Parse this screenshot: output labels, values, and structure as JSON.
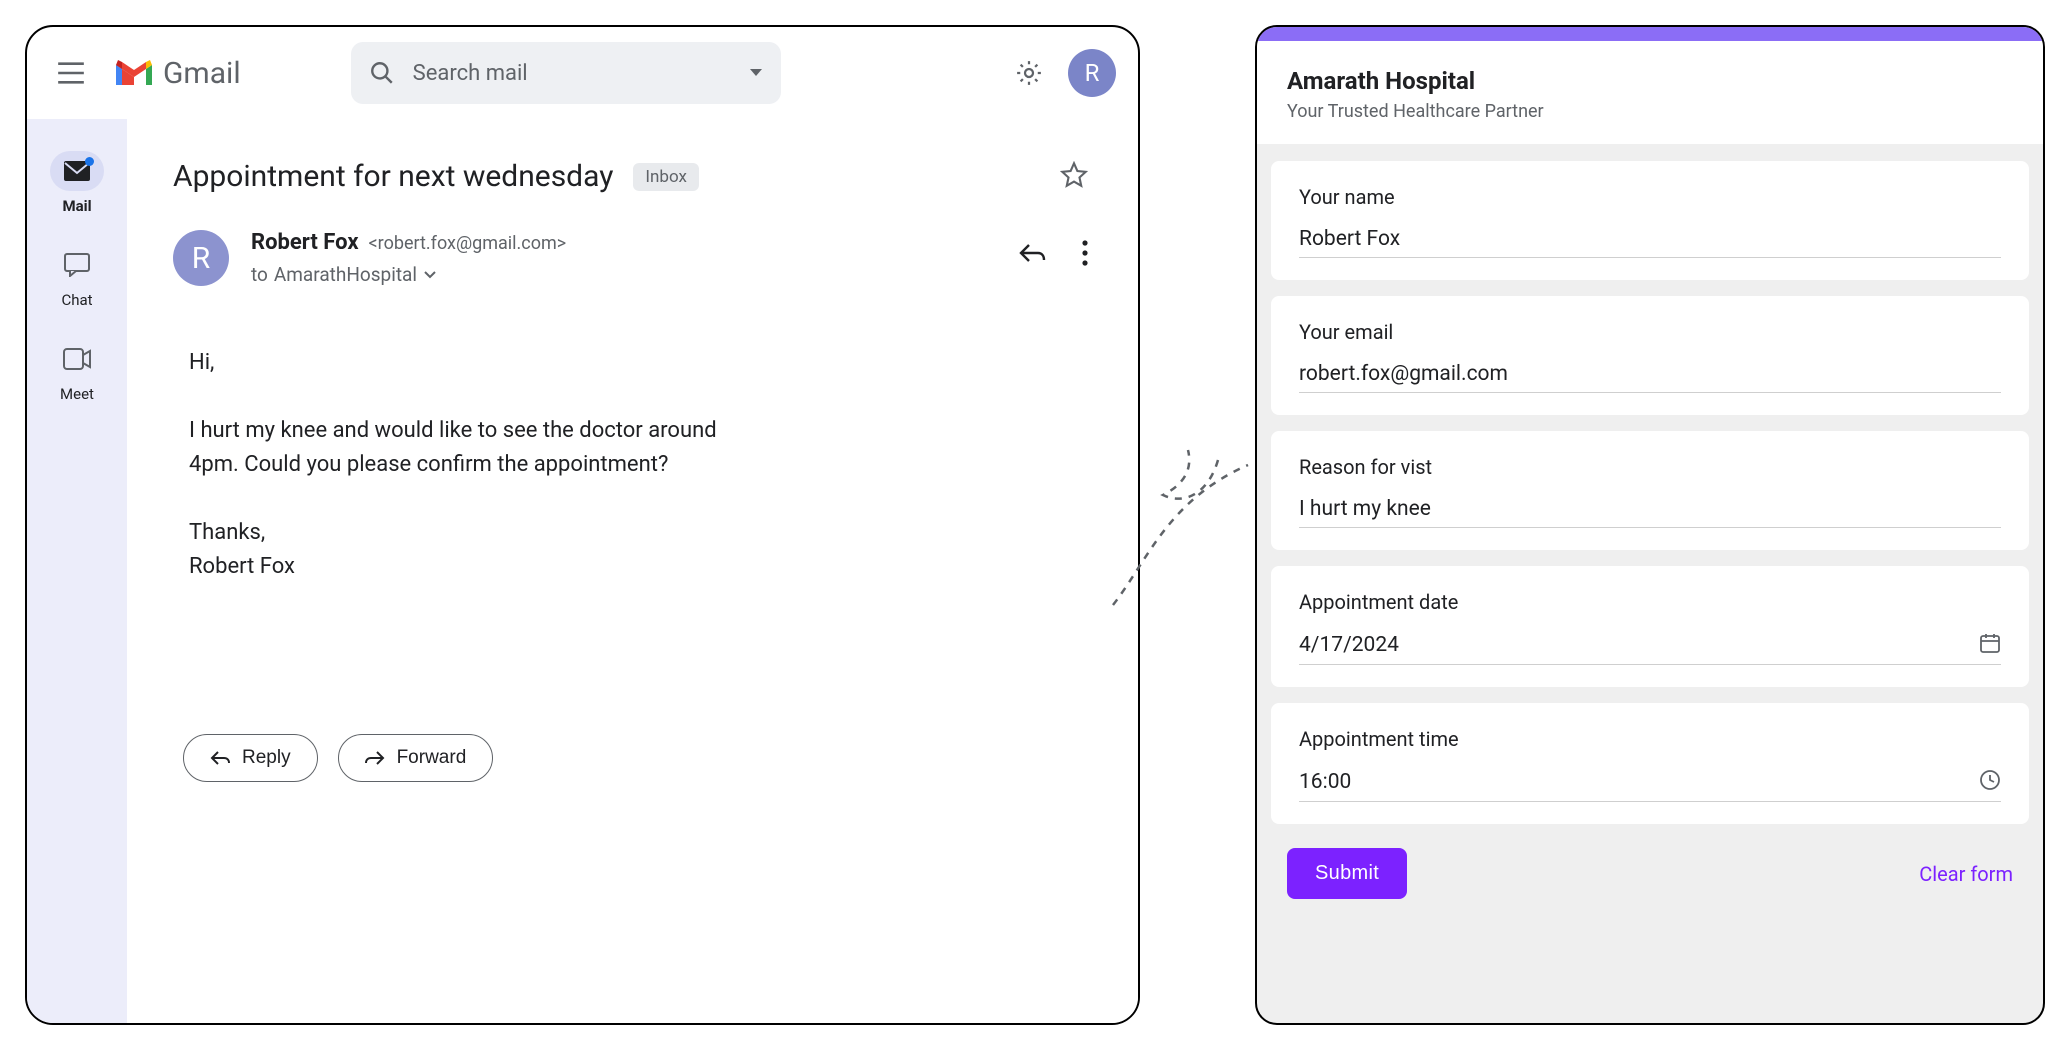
{
  "gmail": {
    "logo_text": "Gmail",
    "search_placeholder": "Search mail",
    "avatar_letter": "R",
    "sidebar": [
      {
        "label": "Mail",
        "icon": "mail",
        "active": true
      },
      {
        "label": "Chat",
        "icon": "chat",
        "active": false
      },
      {
        "label": "Meet",
        "icon": "meet",
        "active": false
      }
    ],
    "email": {
      "subject": "Appointment for next wednesday",
      "chip": "Inbox",
      "sender_name": "Robert Fox",
      "sender_email": "<robert.fox@gmail.com>",
      "sender_initial": "R",
      "recipient_prefix": "to ",
      "recipient": "AmarathHospital",
      "body_greeting": "Hi,",
      "body_main": "I hurt my knee and would like to see the doctor around 4pm. Could you please confirm the appointment?",
      "body_thanks": "Thanks,",
      "body_signature": "Robert Fox",
      "reply_label": "Reply",
      "forward_label": "Forward"
    }
  },
  "form": {
    "title": "Amarath Hospital",
    "subtitle": "Your Trusted Healthcare Partner",
    "fields": {
      "name_label": "Your name",
      "name_value": "Robert Fox",
      "email_label": "Your email",
      "email_value": "robert.fox@gmail.com",
      "reason_label": "Reason for vist",
      "reason_value": "I hurt my knee",
      "date_label": "Appointment date",
      "date_value": "4/17/2024",
      "time_label": "Appointment time",
      "time_value": "16:00"
    },
    "submit_label": "Submit",
    "clear_label": "Clear form"
  }
}
